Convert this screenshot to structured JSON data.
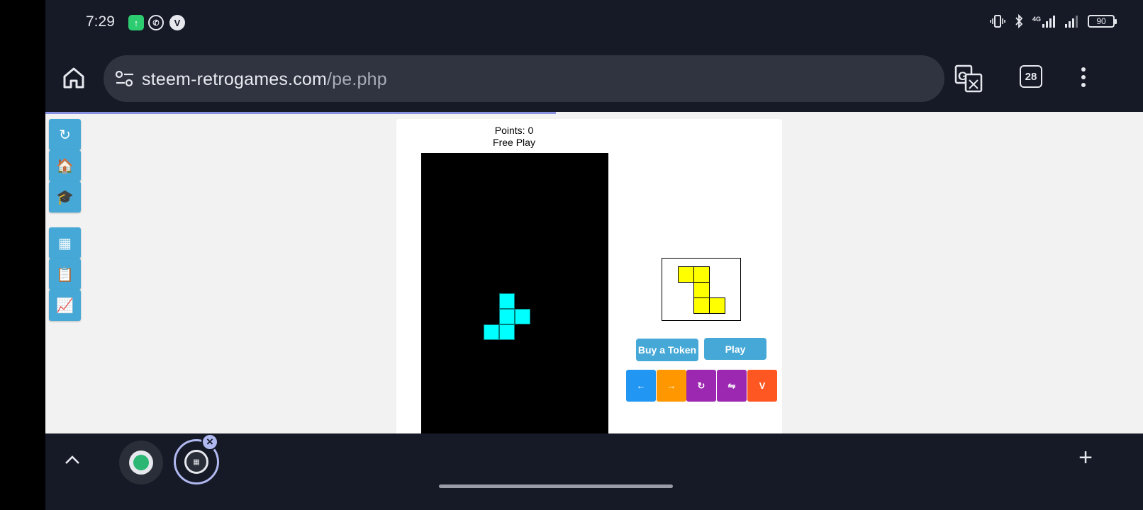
{
  "status_bar": {
    "time": "7:29",
    "network_label": "4G",
    "battery": "90"
  },
  "browser": {
    "url_domain": "steem-retrogames.com",
    "url_path": "/pe.php",
    "tab_count": "28"
  },
  "side_menu": {
    "items": [
      {
        "icon": "↻",
        "name": "reload"
      },
      {
        "icon": "🏠",
        "name": "home"
      },
      {
        "icon": "🎓",
        "name": "learn"
      },
      {
        "icon": "▦",
        "name": "grid"
      },
      {
        "icon": "📋",
        "name": "clipboard"
      },
      {
        "icon": "📈",
        "name": "chart"
      }
    ]
  },
  "game": {
    "points_label": "Points: 0",
    "mode_label": "Free Play",
    "buy_token_label": "Buy a Token",
    "play_label": "Play",
    "controls": [
      {
        "symbol": "←",
        "name": "move-left",
        "color": "#2196f3"
      },
      {
        "symbol": "→",
        "name": "move-right",
        "color": "#ff9800"
      },
      {
        "symbol": "↻",
        "name": "rotate",
        "color": "#9c27b0"
      },
      {
        "symbol": "⇋",
        "name": "swap",
        "color": "#9c27b0"
      },
      {
        "symbol": "V",
        "name": "drop",
        "color": "#ff5722"
      }
    ],
    "board_piece_color": "#00ffff",
    "next_piece_color": "#ffff00"
  },
  "colors": {
    "accent_button": "#45a8d6",
    "system_bar": "#151a26"
  }
}
